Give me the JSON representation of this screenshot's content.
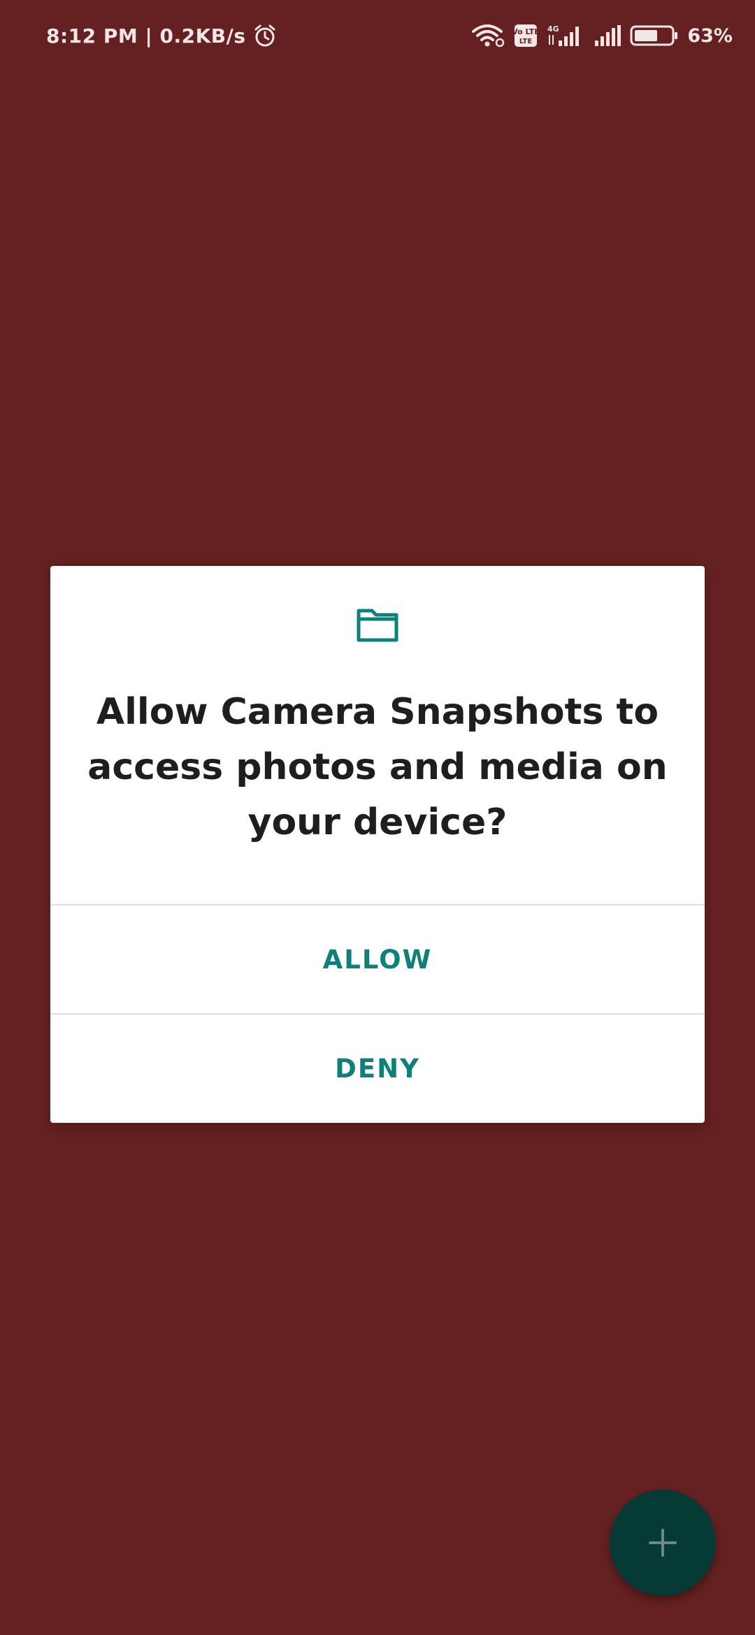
{
  "status_bar": {
    "time_speed": "8:12 PM | 0.2KB/s",
    "battery_percent": "63%",
    "battery_level": 0.63,
    "icons": [
      "alarm-icon",
      "wifi-icon",
      "volte-icon",
      "signal-4g-icon",
      "signal-icon",
      "battery-icon"
    ],
    "volte_label": "Vo LTE",
    "network_label": "4G"
  },
  "dialog": {
    "icon": "folder-icon",
    "message": "Allow Camera Snapshots to access photos and media on your device?",
    "allow_label": "ALLOW",
    "deny_label": "DENY",
    "accent_color": "#0f8079"
  },
  "background_color": "#652121",
  "fab": {
    "icon": "plus-icon",
    "color": "#063a35"
  }
}
